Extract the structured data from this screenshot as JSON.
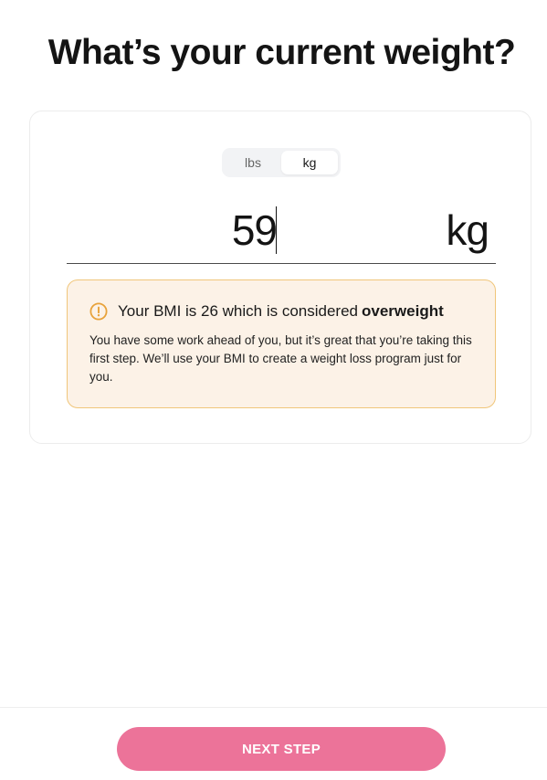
{
  "header": {
    "title": "What’s your current weight?"
  },
  "unit_toggle": {
    "options": [
      {
        "label": "lbs",
        "active": false
      },
      {
        "label": "kg",
        "active": true
      }
    ]
  },
  "weight": {
    "value": "59",
    "unit": "kg"
  },
  "bmi": {
    "heading_prefix": "Your BMI is 26 which is considered",
    "category": "overweight",
    "body": "You have some work ahead of you, but it’s great that you’re taking this first step. We’ll use your BMI to create a weight loss program just for you."
  },
  "footer": {
    "next_label": "NEXT STEP"
  },
  "colors": {
    "accent": "#ec7399",
    "warning": "#e8a23a",
    "warning_bg": "#fcf2e7"
  },
  "icons": {
    "bmi_alert": "exclamation-circle-icon"
  }
}
